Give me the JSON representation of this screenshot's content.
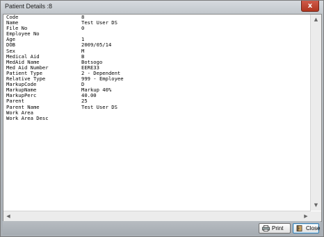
{
  "window": {
    "title": "Patient Details :8",
    "close_glyph": "x"
  },
  "details": [
    {
      "label": "Code",
      "value": "8"
    },
    {
      "label": "Name",
      "value": "Test User DS"
    },
    {
      "label": "File No",
      "value": "0"
    },
    {
      "label": "Employee No",
      "value": ""
    },
    {
      "label": "Age",
      "value": "1"
    },
    {
      "label": "DOB",
      "value": "2009/05/14"
    },
    {
      "label": "Sex",
      "value": "M"
    },
    {
      "label": "Medical Aid",
      "value": "B"
    },
    {
      "label": "MedAid Name",
      "value": "Botsogo"
    },
    {
      "label": "Med Aid Number",
      "value": "EERE33"
    },
    {
      "label": "Patient Type",
      "value": "2 - Dependent"
    },
    {
      "label": "Relative Type",
      "value": "999 - Employee"
    },
    {
      "label": "MarkupCode",
      "value": "D"
    },
    {
      "label": "MarkupName",
      "value": "Markup 40%"
    },
    {
      "label": "MarkupPerc",
      "value": "40.00"
    },
    {
      "label": "Parent",
      "value": "25"
    },
    {
      "label": "Parent Name",
      "value": "Test User DS"
    },
    {
      "label": "Work Area",
      "value": ""
    },
    {
      "label": "Work Area Desc",
      "value": ""
    }
  ],
  "buttons": {
    "print_label": "Print",
    "close_label": "Close"
  },
  "icons": {
    "print": "printer-icon",
    "close": "door-close-icon"
  }
}
